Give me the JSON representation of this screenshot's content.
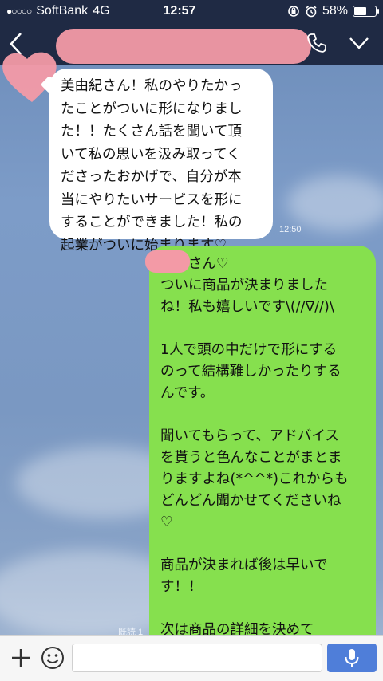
{
  "status_bar": {
    "carrier": "SoftBank",
    "network": "4G",
    "time": "12:57",
    "battery_percent": "58%",
    "battery_level": 0.58
  },
  "header": {
    "contact_name": "",
    "back_icon": "chevron-left-icon",
    "call_icon": "phone-icon",
    "menu_icon": "chevron-down-icon"
  },
  "messages": [
    {
      "direction": "incoming",
      "lines": [
        "美由紀さん！私のやりたかっ",
        "たことがついに形になりまし",
        "た！！たくさん話を聞いて頂",
        "いて私の思いを汲み取ってく",
        "ださったおかげで、自分が本",
        "当にやりたいサービスを形に",
        "することができました！私の",
        "起業がついに始まります♡"
      ],
      "time": "12:50"
    },
    {
      "direction": "outgoing",
      "paragraphs": [
        "　　さん♡\nついに商品が決まりました\nね！私も嬉しいです\\(//∇//)\\",
        "1人で頭の中だけで形にする\nのって結構難しかったりする\nんです。",
        "聞いてもらって、アドバイス\nを貰うと色んなことがまとま\nりますよね(*^^*)これからも\nどんどん聞かせてくださいね\n♡",
        "商品が決まれば後は早いで\nす！！",
        "次は商品の詳細を決めて\n告知に向けて告知文も書いて\nいきましょう！ (>∇<)"
      ],
      "read_label": "既読 1"
    }
  ],
  "composer": {
    "placeholder": "",
    "plus_icon": "plus-icon",
    "emoji_icon": "smiley-icon",
    "mic_icon": "microphone-icon"
  }
}
